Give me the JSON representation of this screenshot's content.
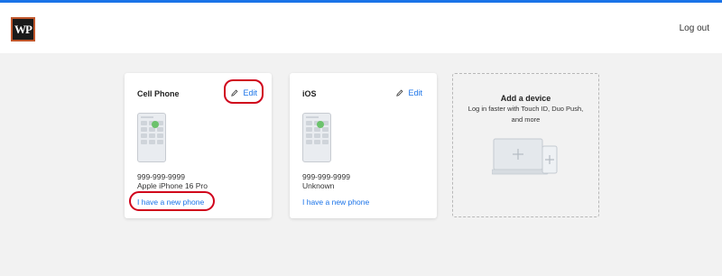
{
  "header": {
    "logo_text": "WP",
    "logout_label": "Log out",
    "accent_color": "#1a73e8"
  },
  "devices": [
    {
      "title": "Cell Phone",
      "edit_label": "Edit",
      "number": "999-999-9999",
      "model": "Apple iPhone 16 Pro",
      "new_phone_label": "I have a new phone"
    },
    {
      "title": "iOS",
      "edit_label": "Edit",
      "number": "999-999-9999",
      "model": "Unknown",
      "new_phone_label": "I have a new phone"
    }
  ],
  "add_device": {
    "title": "Add a device",
    "subtitle": "Log in faster with Touch ID, Duo Push, and more"
  },
  "icons": {
    "edit": "pencil-icon",
    "phone": "phone-illustration",
    "add": "laptop-phone-add-illustration"
  },
  "annotation_color": "#d0021b"
}
